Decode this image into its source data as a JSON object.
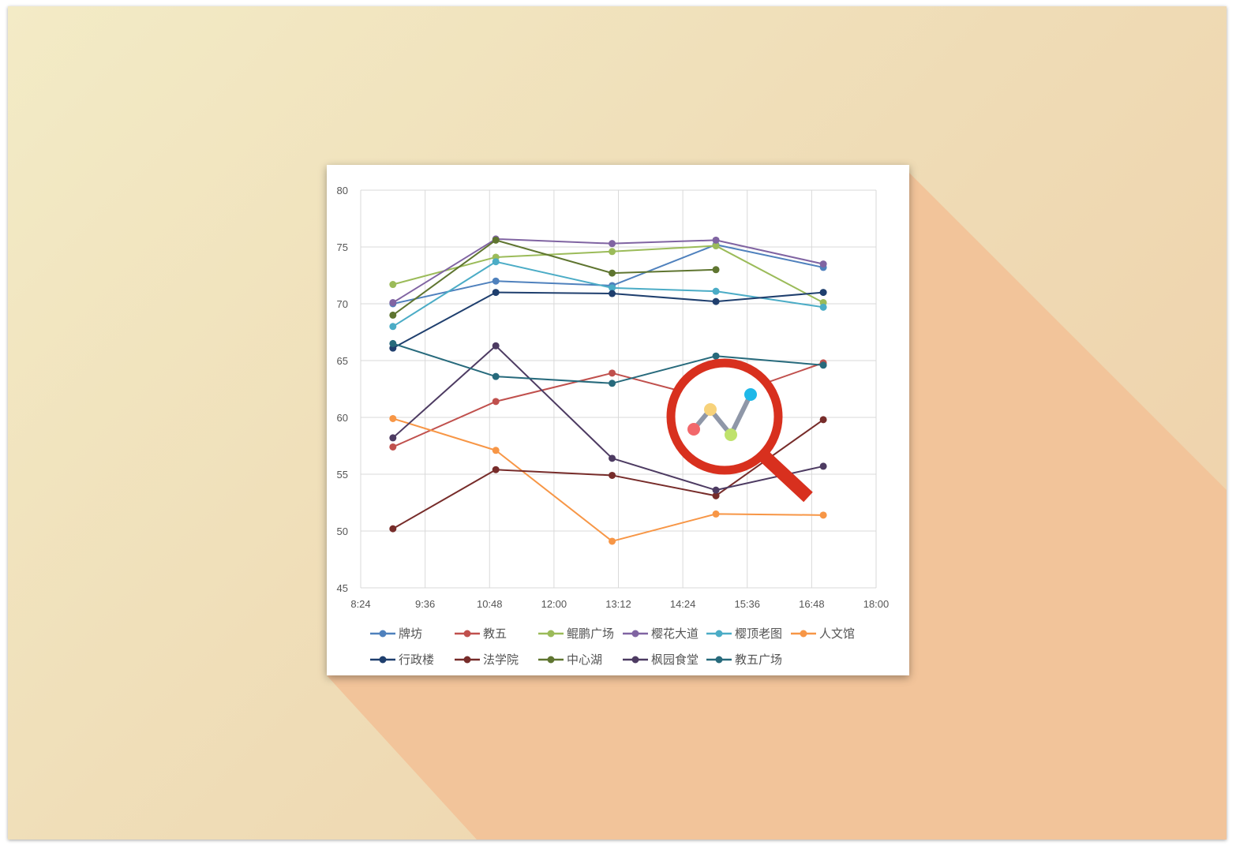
{
  "colors": {
    "bg_start": "#f3ebc6",
    "bg_end": "#efcfa8",
    "long_shadow": "#f2c49a",
    "magnifier_red": "#d8301e",
    "grid": "#d9d9d9"
  },
  "magnifier_icon": {
    "name": "line-chart-search-icon",
    "dot_colors": [
      "#f2686b",
      "#f7d27a",
      "#bfe26c",
      "#1fb8e8"
    ]
  },
  "chart_data": {
    "type": "line",
    "title": "",
    "xlabel": "",
    "ylabel": "",
    "x_ticks": [
      "8:24",
      "9:36",
      "10:48",
      "12:00",
      "13:12",
      "14:24",
      "15:36",
      "16:48",
      "18:00"
    ],
    "xlim": [
      "8:24",
      "18:00"
    ],
    "y_ticks": [
      "80",
      "75",
      "70",
      "65",
      "60",
      "55",
      "50",
      "45"
    ],
    "ylim": [
      45,
      80
    ],
    "grid": true,
    "legend_position": "bottom",
    "x": [
      "9:00",
      "10:55",
      "13:05",
      "15:01",
      "17:01"
    ],
    "series": [
      {
        "name": "牌坊",
        "color": "#4f81bd",
        "values": [
          70,
          72,
          71.6,
          75.2,
          73.2
        ]
      },
      {
        "name": "教五",
        "color": "#c0504d",
        "values": [
          57.4,
          61.4,
          63.9,
          61.5,
          64.8
        ]
      },
      {
        "name": "鲲鹏广场",
        "color": "#9bbb59",
        "values": [
          71.7,
          74.1,
          74.6,
          75.1,
          70.1
        ]
      },
      {
        "name": "樱花大道",
        "color": "#8064a2",
        "values": [
          70.1,
          75.7,
          75.3,
          75.6,
          73.5
        ]
      },
      {
        "name": "樱顶老图",
        "color": "#4bacc6",
        "values": [
          68,
          73.7,
          71.4,
          71.1,
          69.7
        ]
      },
      {
        "name": "人文馆",
        "color": "#f79646",
        "values": [
          59.9,
          57.1,
          49.1,
          51.5,
          51.4
        ]
      },
      {
        "name": "行政楼",
        "color": "#1f3f6e",
        "values": [
          66.1,
          71,
          70.9,
          70.2,
          71
        ]
      },
      {
        "name": "法学院",
        "color": "#772c2a",
        "values": [
          50.2,
          55.4,
          54.9,
          53.1,
          59.8
        ]
      },
      {
        "name": "中心湖",
        "color": "#5f7530",
        "values": [
          69,
          75.6,
          72.7,
          73,
          null
        ]
      },
      {
        "name": "枫园食堂",
        "color": "#4d3b62",
        "values": [
          58.2,
          66.3,
          56.4,
          53.6,
          55.7
        ]
      },
      {
        "name": "教五广场",
        "color": "#276a7c",
        "values": [
          66.5,
          63.6,
          63,
          65.4,
          64.6
        ]
      }
    ]
  }
}
